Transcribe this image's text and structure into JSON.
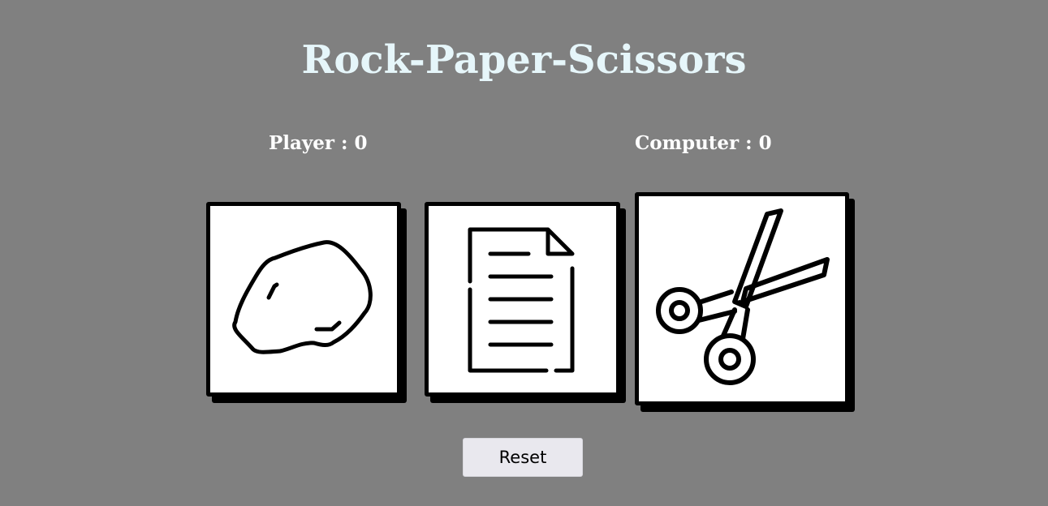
{
  "title": "Rock-Paper-Scissors",
  "scores": {
    "player_label": "Player : 0",
    "computer_label": "Computer : 0"
  },
  "choices": [
    {
      "name": "rock",
      "icon": "rock-icon"
    },
    {
      "name": "paper",
      "icon": "paper-icon"
    },
    {
      "name": "scissors",
      "icon": "scissors-icon"
    }
  ],
  "reset_label": "Reset",
  "colors": {
    "background": "#808080",
    "title": "#e6f6fa",
    "score_text": "#ffffff",
    "card_background": "#ffffff",
    "card_border": "#000000",
    "button_background": "#e9e8ee"
  }
}
